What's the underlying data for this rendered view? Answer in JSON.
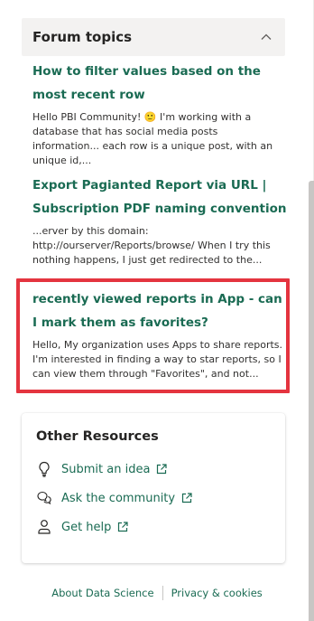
{
  "top_partial_text": "...",
  "forum": {
    "header_title": "Forum topics",
    "topics": [
      {
        "title": "How to filter values based on the most recent row",
        "body": "Hello PBI Community! 🙂 I'm working with a database that has social media posts information... each row is a unique post, with an unique id,..."
      },
      {
        "title": "Export Pagianted Report via URL | Subscription PDF naming convention",
        "body": "...erver by this domain: http://ourserver/Reports/browse/ When I try this nothing happens, I just get redirected to the..."
      },
      {
        "title": "recently viewed reports in App - can I mark them as favorites?",
        "body": "Hello, My organization uses Apps to share reports. I'm interested in finding a way to star reports, so I can view them through \"Favorites\", and not..."
      }
    ]
  },
  "resources": {
    "title": "Other Resources",
    "links": [
      {
        "label": "Submit an idea",
        "icon": "lightbulb-icon"
      },
      {
        "label": "Ask the community",
        "icon": "chat-icon"
      },
      {
        "label": "Get help",
        "icon": "person-help-icon"
      }
    ]
  },
  "footer": {
    "about": "About Data Science",
    "privacy": "Privacy & cookies"
  },
  "colors": {
    "link": "#1a6b53",
    "highlight": "#e4343f",
    "header_bg": "#f3f2f1"
  }
}
